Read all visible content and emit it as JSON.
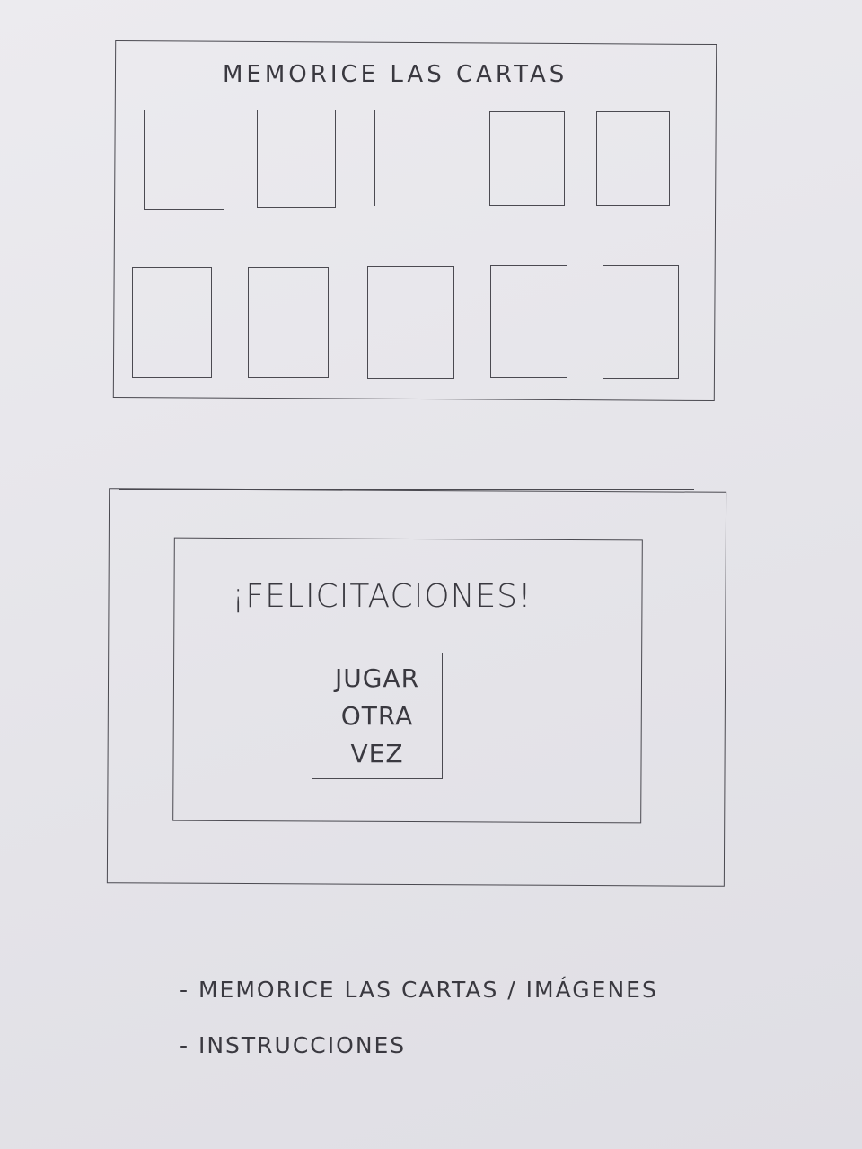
{
  "memory_screen": {
    "title": "MEMORICE LAS CARTAS",
    "card_rows": 2,
    "cards_per_row": 5
  },
  "win_screen": {
    "message": "¡FELICITACIONES!",
    "play_again_lines": [
      "JUGAR",
      "OTRA",
      "VEZ"
    ]
  },
  "notes": [
    "- MEMORICE LAS CARTAS / IMÁGENES",
    "- INSTRUCCIONES"
  ]
}
